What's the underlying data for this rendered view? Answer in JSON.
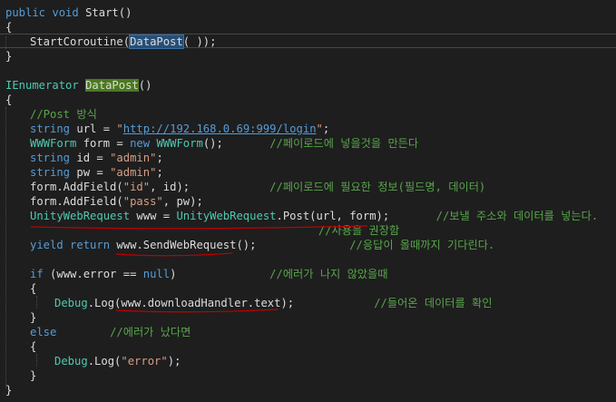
{
  "code": [
    {
      "indent": 0,
      "tokens": [
        {
          "t": "kw",
          "v": "public"
        },
        {
          "t": "id",
          "v": " "
        },
        {
          "t": "kw",
          "v": "void"
        },
        {
          "t": "id",
          "v": " Start()"
        }
      ]
    },
    {
      "indent": 0,
      "tokens": [
        {
          "t": "id",
          "v": "{"
        }
      ]
    },
    {
      "indent": 1,
      "tokens": [
        {
          "t": "id",
          "v": "StartCoroutine("
        },
        {
          "t": "hlb",
          "v": "DataPost"
        },
        {
          "t": "id",
          "v": "( ));"
        }
      ]
    },
    {
      "indent": 0,
      "tokens": [
        {
          "t": "id",
          "v": "}"
        }
      ]
    },
    {
      "indent": 0,
      "tokens": []
    },
    {
      "indent": 0,
      "tokens": [
        {
          "t": "ty",
          "v": "IEnumerator"
        },
        {
          "t": "id",
          "v": " "
        },
        {
          "t": "hlg",
          "v": "DataPost"
        },
        {
          "t": "id",
          "v": "()"
        }
      ]
    },
    {
      "indent": 0,
      "tokens": [
        {
          "t": "id",
          "v": "{"
        }
      ]
    },
    {
      "indent": 1,
      "tokens": [
        {
          "t": "cm",
          "v": "//Post 방식"
        }
      ]
    },
    {
      "indent": 1,
      "tokens": [
        {
          "t": "kw",
          "v": "string"
        },
        {
          "t": "id",
          "v": " url = "
        },
        {
          "t": "str",
          "v": "\""
        },
        {
          "t": "url",
          "v": "http://192.168.0.69:999/login"
        },
        {
          "t": "str",
          "v": "\""
        },
        {
          "t": "id",
          "v": ";"
        }
      ]
    },
    {
      "indent": 1,
      "tokens": [
        {
          "t": "ty",
          "v": "WWWForm"
        },
        {
          "t": "id",
          "v": " form = "
        },
        {
          "t": "kw",
          "v": "new"
        },
        {
          "t": "id",
          "v": " "
        },
        {
          "t": "ty",
          "v": "WWWForm"
        },
        {
          "t": "id",
          "v": "();       "
        },
        {
          "t": "cm",
          "v": "//페이로드에 넣을것을 만든다"
        }
      ]
    },
    {
      "indent": 1,
      "tokens": [
        {
          "t": "kw",
          "v": "string"
        },
        {
          "t": "id",
          "v": " id = "
        },
        {
          "t": "str",
          "v": "\"admin\""
        },
        {
          "t": "id",
          "v": ";"
        }
      ]
    },
    {
      "indent": 1,
      "tokens": [
        {
          "t": "kw",
          "v": "string"
        },
        {
          "t": "id",
          "v": " pw = "
        },
        {
          "t": "str",
          "v": "\"admin\""
        },
        {
          "t": "id",
          "v": ";"
        }
      ]
    },
    {
      "indent": 1,
      "tokens": [
        {
          "t": "id",
          "v": "form.AddField("
        },
        {
          "t": "str",
          "v": "\"id\""
        },
        {
          "t": "id",
          "v": ", id);            "
        },
        {
          "t": "cm",
          "v": "//페이로드에 필요한 정보(필드명, 데이터)"
        }
      ]
    },
    {
      "indent": 1,
      "tokens": [
        {
          "t": "id",
          "v": "form.AddField("
        },
        {
          "t": "str",
          "v": "\"pass\""
        },
        {
          "t": "id",
          "v": ", pw);"
        }
      ]
    },
    {
      "indent": 1,
      "tokens": [
        {
          "t": "ty",
          "v": "UnityWebRequest"
        },
        {
          "t": "id",
          "v": " www = "
        },
        {
          "t": "ty",
          "v": "UnityWebRequest"
        },
        {
          "t": "id",
          "v": ".Post(url, form);       "
        },
        {
          "t": "cm",
          "v": "//보낼 주소와 데이터를 넣는다."
        }
      ]
    },
    {
      "indent": 0,
      "tokens": [
        {
          "t": "id",
          "v": "                                               "
        },
        {
          "t": "cm",
          "v": "//사용을 권장함"
        }
      ]
    },
    {
      "indent": 1,
      "tokens": [
        {
          "t": "kw",
          "v": "yield"
        },
        {
          "t": "id",
          "v": " "
        },
        {
          "t": "kw",
          "v": "return"
        },
        {
          "t": "id",
          "v": " www.SendWebRequest();              "
        },
        {
          "t": "cm",
          "v": "//응답이 올때까지 기다린다."
        }
      ]
    },
    {
      "indent": 0,
      "tokens": []
    },
    {
      "indent": 1,
      "tokens": [
        {
          "t": "kw",
          "v": "if"
        },
        {
          "t": "id",
          "v": " (www.error == "
        },
        {
          "t": "kw",
          "v": "null"
        },
        {
          "t": "id",
          "v": ")              "
        },
        {
          "t": "cm",
          "v": "//에러가 나지 않았을때"
        }
      ]
    },
    {
      "indent": 1,
      "tokens": [
        {
          "t": "id",
          "v": "{"
        }
      ]
    },
    {
      "indent": 2,
      "tokens": [
        {
          "t": "ty",
          "v": "Debug"
        },
        {
          "t": "id",
          "v": ".Log(www.downloadHandler.text);            "
        },
        {
          "t": "cm",
          "v": "//들어온 데이터를 확인"
        }
      ]
    },
    {
      "indent": 1,
      "tokens": [
        {
          "t": "id",
          "v": "}"
        }
      ]
    },
    {
      "indent": 1,
      "tokens": [
        {
          "t": "kw",
          "v": "else"
        },
        {
          "t": "id",
          "v": "        "
        },
        {
          "t": "cm",
          "v": "//에러가 났다면"
        }
      ]
    },
    {
      "indent": 1,
      "tokens": [
        {
          "t": "id",
          "v": "{"
        }
      ]
    },
    {
      "indent": 2,
      "tokens": [
        {
          "t": "ty",
          "v": "Debug"
        },
        {
          "t": "id",
          "v": ".Log("
        },
        {
          "t": "str",
          "v": "\"error\""
        },
        {
          "t": "id",
          "v": ");"
        }
      ]
    },
    {
      "indent": 1,
      "tokens": [
        {
          "t": "id",
          "v": "}"
        }
      ]
    },
    {
      "indent": 0,
      "tokens": [
        {
          "t": "id",
          "v": "}"
        }
      ]
    }
  ],
  "colors": {
    "background": "#1e1e1e",
    "keyword": "#569cd6",
    "type": "#4ec9b0",
    "string": "#d69d85",
    "comment": "#57a64a",
    "annotation": "#c00000"
  }
}
